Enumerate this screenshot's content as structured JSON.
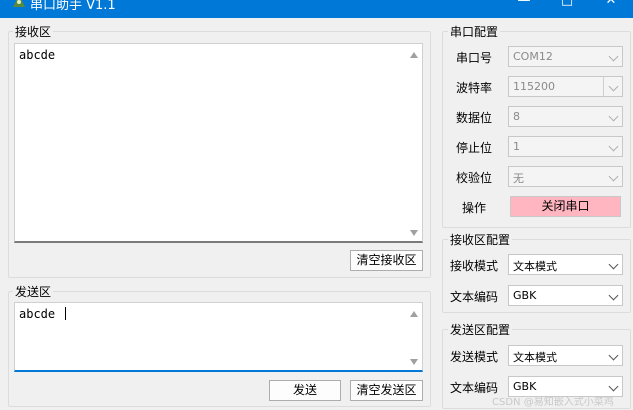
{
  "window": {
    "title": "串口助手 V1.1"
  },
  "receive": {
    "group_label": "接收区",
    "content": "abcde",
    "clear_label": "清空接收区"
  },
  "send": {
    "group_label": "发送区",
    "content": "abcde",
    "send_label": "发送",
    "clear_label": "清空发送区"
  },
  "serial": {
    "group_label": "串口配置",
    "port_label": "串口号",
    "port_value": "COM12",
    "baud_label": "波特率",
    "baud_value": "115200",
    "databits_label": "数据位",
    "databits_value": "8",
    "stopbits_label": "停止位",
    "stopbits_value": "1",
    "parity_label": "校验位",
    "parity_value": "无",
    "op_label": "操作",
    "close_port_label": "关闭串口"
  },
  "recv_config": {
    "group_label": "接收区配置",
    "mode_label": "接收模式",
    "mode_value": "文本模式",
    "encoding_label": "文本编码",
    "encoding_value": "GBK"
  },
  "send_config": {
    "group_label": "发送区配置",
    "mode_label": "发送模式",
    "mode_value": "文本模式",
    "encoding_label": "文本编码",
    "encoding_value": "GBK"
  },
  "watermark": "CSDN @易知嵌入式小菜鸡",
  "colors": {
    "titlebar": "#0078d7",
    "close_port_button": "#ffb6c1",
    "focus": "#0078d7"
  }
}
